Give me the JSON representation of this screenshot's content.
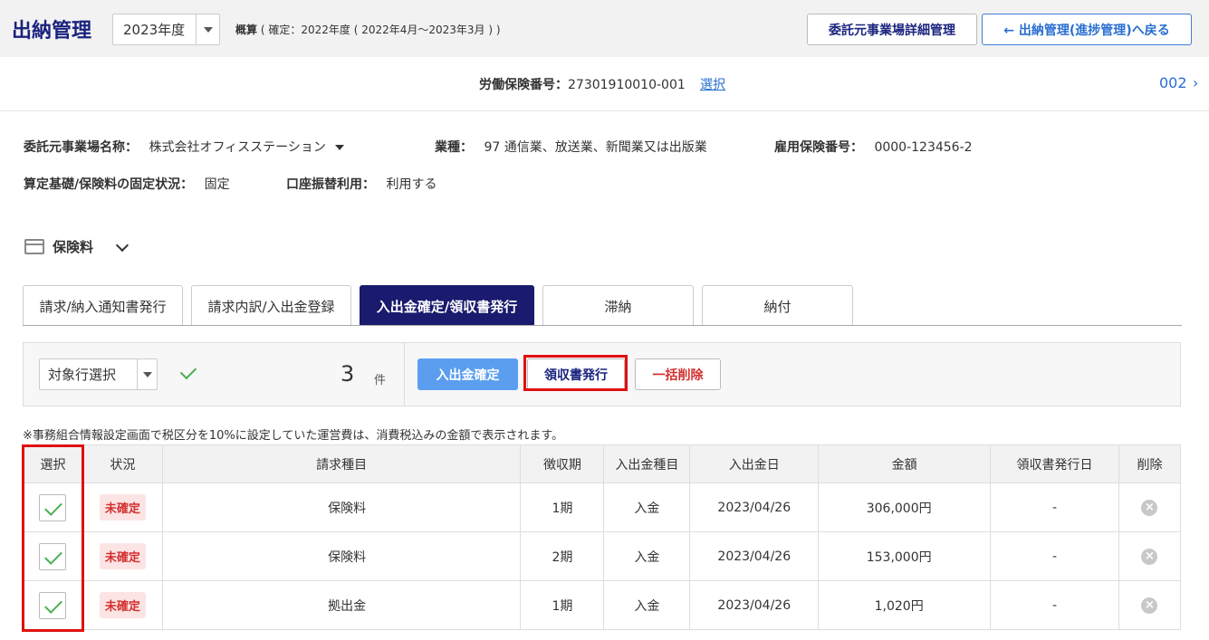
{
  "header": {
    "title": "出納管理",
    "year_value": "2023年度",
    "summary_label": "概算",
    "summary_text": "( 確定：2022年度 ( 2022年4月～2023年3月 ) )",
    "detail_button": "委託元事業場詳細管理",
    "back_button": "← 出納管理(進捗管理)へ戻る"
  },
  "insurance": {
    "label": "労働保険番号：",
    "number": "27301910010-001",
    "select_link": "選択",
    "page": "002",
    "next": "›"
  },
  "info": {
    "client_label": "委託元事業場名称：",
    "client_value": "株式会社オフィスステーション",
    "industry_label": "業種：",
    "industry_value": "97 通信業、放送業、新聞業又は出版業",
    "employment_label": "雇用保険番号：",
    "employment_value": "0000-123456-2",
    "fixed_label": "算定基礎/保険料の固定状況：",
    "fixed_value": "固定",
    "transfer_label": "口座振替利用：",
    "transfer_value": "利用する"
  },
  "section": {
    "title": "保険料"
  },
  "tabs": [
    {
      "label": "請求/納入通知書発行"
    },
    {
      "label": "請求内訳/入出金登録"
    },
    {
      "label": "入出金確定/領収書発行"
    },
    {
      "label": "滞納"
    },
    {
      "label": "納付"
    }
  ],
  "actions": {
    "row_select": "対象行選択",
    "count": "3",
    "count_unit": "件",
    "confirm": "入出金確定",
    "receipt": "領収書発行",
    "bulk_delete": "一括削除"
  },
  "note": "※事務組合情報設定画面で税区分を10%に設定していた運営費は、消費税込みの金額で表示されます。",
  "table": {
    "headers": [
      "選択",
      "状況",
      "請求種目",
      "徴収期",
      "入出金種目",
      "入出金日",
      "金額",
      "領収書発行日",
      "削除"
    ],
    "rows": [
      {
        "status": "未確定",
        "item": "保険料",
        "period": "1期",
        "type": "入金",
        "date": "2023/04/26",
        "amount": "306,000円",
        "receipt_date": "-"
      },
      {
        "status": "未確定",
        "item": "保険料",
        "period": "2期",
        "type": "入金",
        "date": "2023/04/26",
        "amount": "153,000円",
        "receipt_date": "-"
      },
      {
        "status": "未確定",
        "item": "拠出金",
        "period": "1期",
        "type": "入金",
        "date": "2023/04/26",
        "amount": "1,020円",
        "receipt_date": "-"
      }
    ]
  },
  "colors": {
    "title": "#1a237e",
    "active_tab": "#1a1a6e",
    "link": "#2a6fd1",
    "highlight": "#e01010",
    "confirm_btn": "#5b9ef0"
  }
}
